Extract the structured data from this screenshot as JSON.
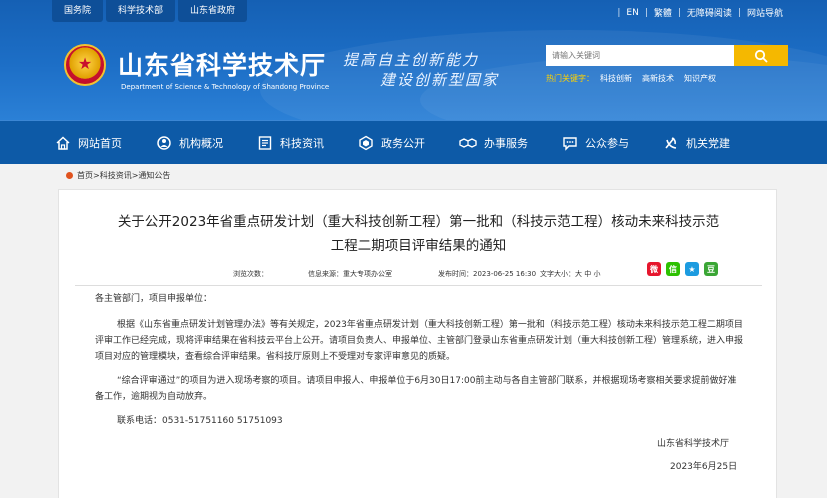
{
  "header": {
    "top_links": [
      "国务院",
      "科学技术部",
      "山东省政府"
    ],
    "right_links": [
      "EN",
      "繁體",
      "无障碍阅读",
      "网站导航"
    ],
    "site_name": "山东省科学技术厅",
    "site_name_en": "Department of Science & Technology of Shandong Province",
    "slogan_line1": "提高自主创新能力",
    "slogan_line2": "建设创新型国家",
    "search_placeholder": "请输入关键词",
    "hot_label": "热门关键字：",
    "hot_keywords": [
      "科技创新",
      "高新技术",
      "知识产权"
    ]
  },
  "nav": {
    "items": [
      {
        "label": "网站首页",
        "icon": "home-icon"
      },
      {
        "label": "机构概况",
        "icon": "org-icon"
      },
      {
        "label": "科技资讯",
        "icon": "news-icon"
      },
      {
        "label": "政务公开",
        "icon": "gov-icon"
      },
      {
        "label": "办事服务",
        "icon": "handshake-icon"
      },
      {
        "label": "公众参与",
        "icon": "chat-icon"
      },
      {
        "label": "机关党建",
        "icon": "party-icon"
      }
    ]
  },
  "breadcrumb": "首页>科技资讯>通知公告",
  "article": {
    "title_line1": "关于公开2023年省重点研发计划（重大科技创新工程）第一批和（科技示范工程）核动未来科技示范",
    "title_line2": "工程二期项目评审结果的通知",
    "views": "浏览次数：",
    "source": "信息来源：重大专项办公室",
    "time": "发布时间：2023-06-25 16:30",
    "font_size": "文字大小：大 中 小",
    "greeting": "各主管部门，项目申报单位：",
    "p1": "根据《山东省重点研发计划管理办法》等有关规定，2023年省重点研发计划（重大科技创新工程）第一批和（科技示范工程）核动未来科技示范工程二期项目评审工作已经完成，现将评审结果在省科技云平台上公开。请项目负责人、申报单位、主管部门登录山东省重点研发计划（重大科技创新工程）管理系统，进入申报项目对应的管理模块，查看综合评审结果。省科技厅原则上不受理对专家评审意见的质疑。",
    "p2": "“综合评审通过”的项目为进入现场考察的项目。请项目申报人、申报单位于6月30日17:00前主动与各自主管部门联系，并根据现场考察相关要求提前做好准备工作，逾期视为自动放弃。",
    "contact": "联系电话：0531-51751160  51751093",
    "signature": "山东省科学技术厅",
    "date": "2023年6月25日"
  },
  "colors": {
    "header_blue": "#1d6fc7",
    "nav_blue": "#0d5aa7",
    "search_button": "#f5b800",
    "hot_label": "#ffd200"
  }
}
